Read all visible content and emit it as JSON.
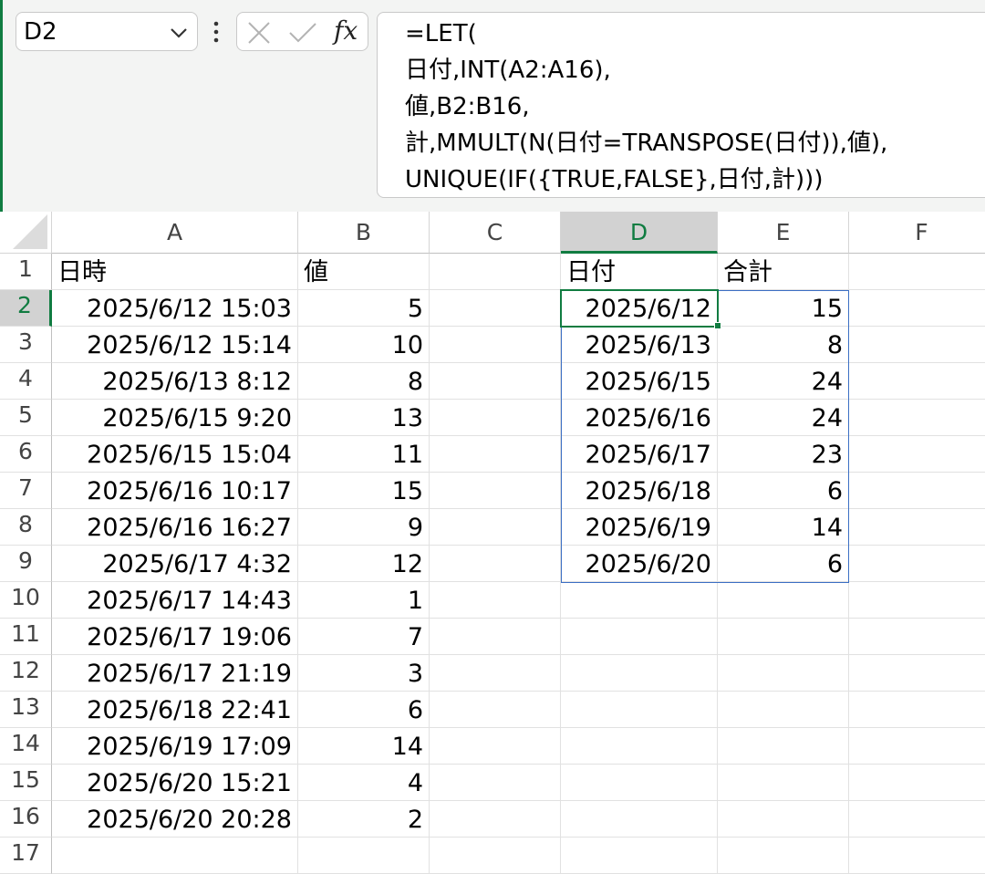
{
  "name_box": {
    "value": "D2"
  },
  "formula_bar": {
    "fx_label": "fx",
    "lines": [
      "=LET(",
      "日付,INT(A2:A16),",
      "値,B2:B16,",
      "計,MMULT(N(日付=TRANSPOSE(日付)),値),",
      "UNIQUE(IF({TRUE,FALSE},日付,計)))"
    ]
  },
  "grid": {
    "columns": [
      "A",
      "B",
      "C",
      "D",
      "E",
      "F"
    ],
    "active_column": "D",
    "active_row": "2",
    "rows": [
      {
        "n": "1",
        "A": "日時",
        "B": "値",
        "C": "",
        "D": "日付",
        "E": "合計",
        "F": ""
      },
      {
        "n": "2",
        "A": "2025/6/12 15:03",
        "B": "5",
        "C": "",
        "D": "2025/6/12",
        "E": "15",
        "F": ""
      },
      {
        "n": "3",
        "A": "2025/6/12 15:14",
        "B": "10",
        "C": "",
        "D": "2025/6/13",
        "E": "8",
        "F": ""
      },
      {
        "n": "4",
        "A": "2025/6/13 8:12",
        "B": "8",
        "C": "",
        "D": "2025/6/15",
        "E": "24",
        "F": ""
      },
      {
        "n": "5",
        "A": "2025/6/15 9:20",
        "B": "13",
        "C": "",
        "D": "2025/6/16",
        "E": "24",
        "F": ""
      },
      {
        "n": "6",
        "A": "2025/6/15 15:04",
        "B": "11",
        "C": "",
        "D": "2025/6/17",
        "E": "23",
        "F": ""
      },
      {
        "n": "7",
        "A": "2025/6/16 10:17",
        "B": "15",
        "C": "",
        "D": "2025/6/18",
        "E": "6",
        "F": ""
      },
      {
        "n": "8",
        "A": "2025/6/16 16:27",
        "B": "9",
        "C": "",
        "D": "2025/6/19",
        "E": "14",
        "F": ""
      },
      {
        "n": "9",
        "A": "2025/6/17 4:32",
        "B": "12",
        "C": "",
        "D": "2025/6/20",
        "E": "6",
        "F": ""
      },
      {
        "n": "10",
        "A": "2025/6/17 14:43",
        "B": "1",
        "C": "",
        "D": "",
        "E": "",
        "F": ""
      },
      {
        "n": "11",
        "A": "2025/6/17 19:06",
        "B": "7",
        "C": "",
        "D": "",
        "E": "",
        "F": ""
      },
      {
        "n": "12",
        "A": "2025/6/17 21:19",
        "B": "3",
        "C": "",
        "D": "",
        "E": "",
        "F": ""
      },
      {
        "n": "13",
        "A": "2025/6/18 22:41",
        "B": "6",
        "C": "",
        "D": "",
        "E": "",
        "F": ""
      },
      {
        "n": "14",
        "A": "2025/6/19 17:09",
        "B": "14",
        "C": "",
        "D": "",
        "E": "",
        "F": ""
      },
      {
        "n": "15",
        "A": "2025/6/20 15:21",
        "B": "4",
        "C": "",
        "D": "",
        "E": "",
        "F": ""
      },
      {
        "n": "16",
        "A": "2025/6/20 20:28",
        "B": "2",
        "C": "",
        "D": "",
        "E": "",
        "F": ""
      },
      {
        "n": "17",
        "A": "",
        "B": "",
        "C": "",
        "D": "",
        "E": "",
        "F": ""
      }
    ]
  },
  "colors": {
    "accent": "#107c41",
    "spill_border": "#3b6fc4"
  }
}
